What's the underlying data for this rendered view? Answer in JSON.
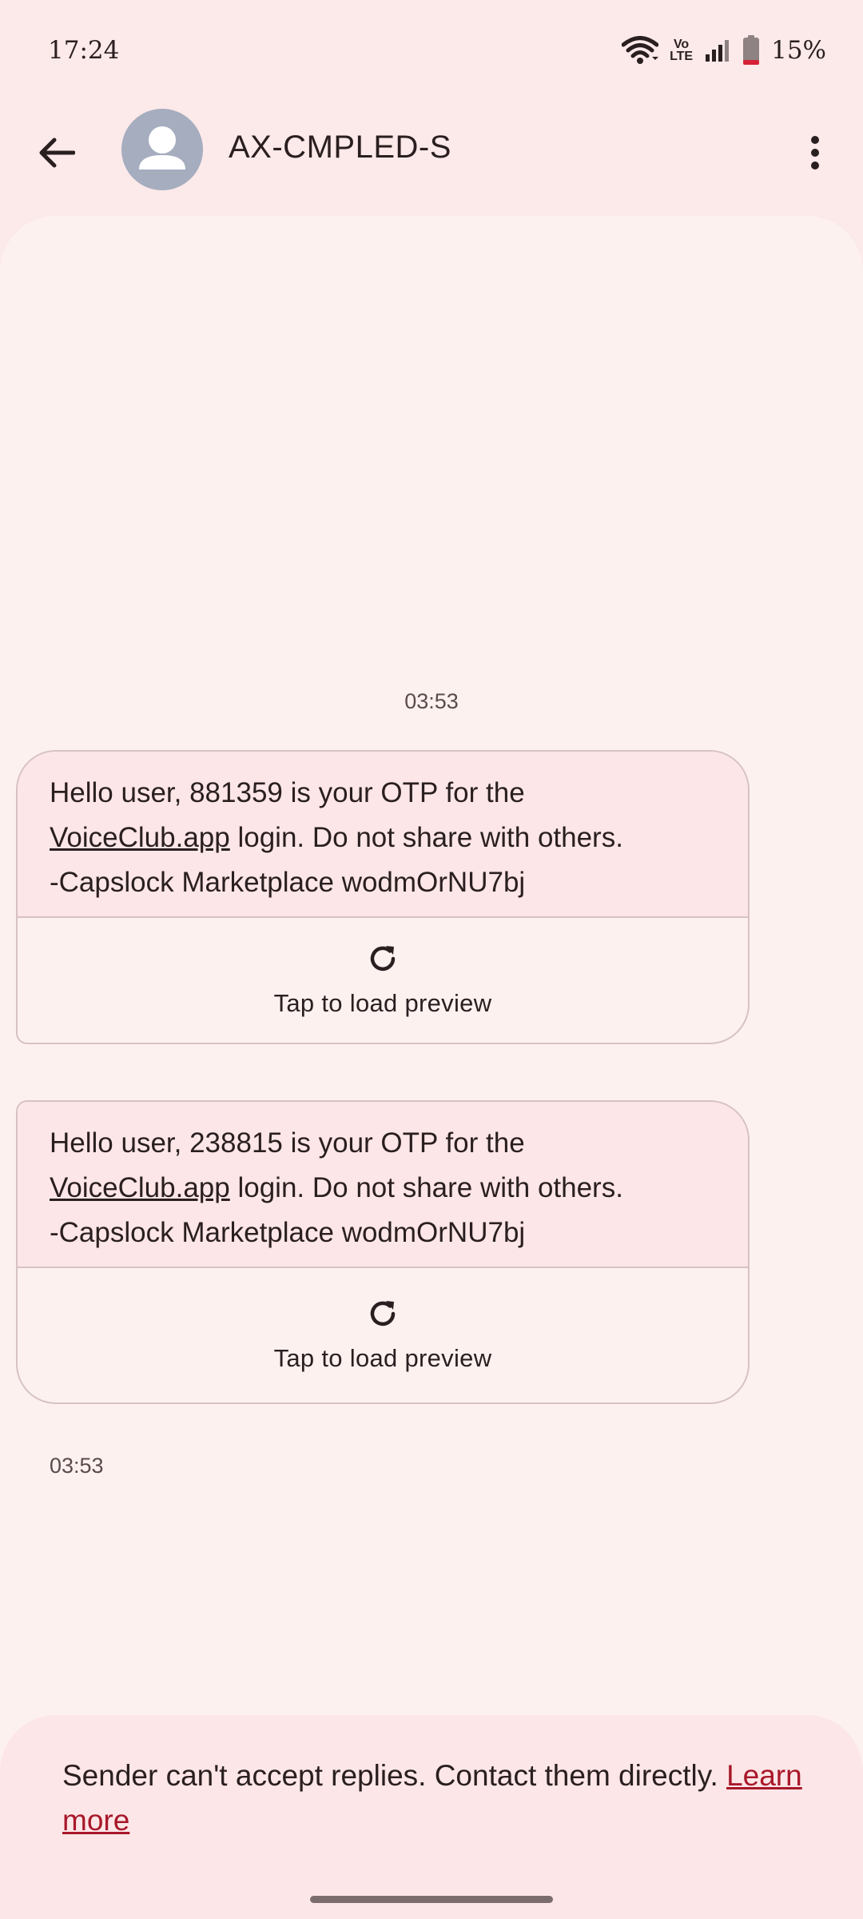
{
  "status_bar": {
    "time": "17:24",
    "volte_label_top": "Vo",
    "volte_label_bottom": "LTE",
    "battery_percent": "15%"
  },
  "app_bar": {
    "contact_name": "AX-CMPLED-S"
  },
  "conversation": {
    "date_header": "03:53",
    "messages": [
      {
        "line1": "Hello user, 881359 is your OTP for the",
        "link_text": "VoiceClub.app",
        "line2_rest": " login. Do not share with others.",
        "line3": "-Capslock Marketplace wodmOrNU7bj",
        "preview_label": "Tap to load preview"
      },
      {
        "line1": "Hello user, 238815 is your OTP for the",
        "link_text": "VoiceClub.app",
        "line2_rest": " login. Do not share with others.",
        "line3": "-Capslock Marketplace wodmOrNU7bj",
        "preview_label": "Tap to load preview"
      }
    ],
    "last_timestamp": "03:53"
  },
  "notice": {
    "text": "Sender can't accept replies. Contact them directly. ",
    "learn_more": "Learn more"
  },
  "icons": {
    "back": "arrow-back-icon",
    "avatar": "person-icon",
    "more": "more-vert-icon",
    "refresh": "refresh-icon",
    "wifi": "wifi-icon",
    "signal": "signal-icon",
    "battery": "battery-icon"
  },
  "colors": {
    "background": "#fce9e9",
    "panel": "#fdf1f0",
    "bubble_text_bg": "#fde6e7",
    "link_accent": "#a8182a",
    "avatar_bg": "#a5adbf"
  }
}
